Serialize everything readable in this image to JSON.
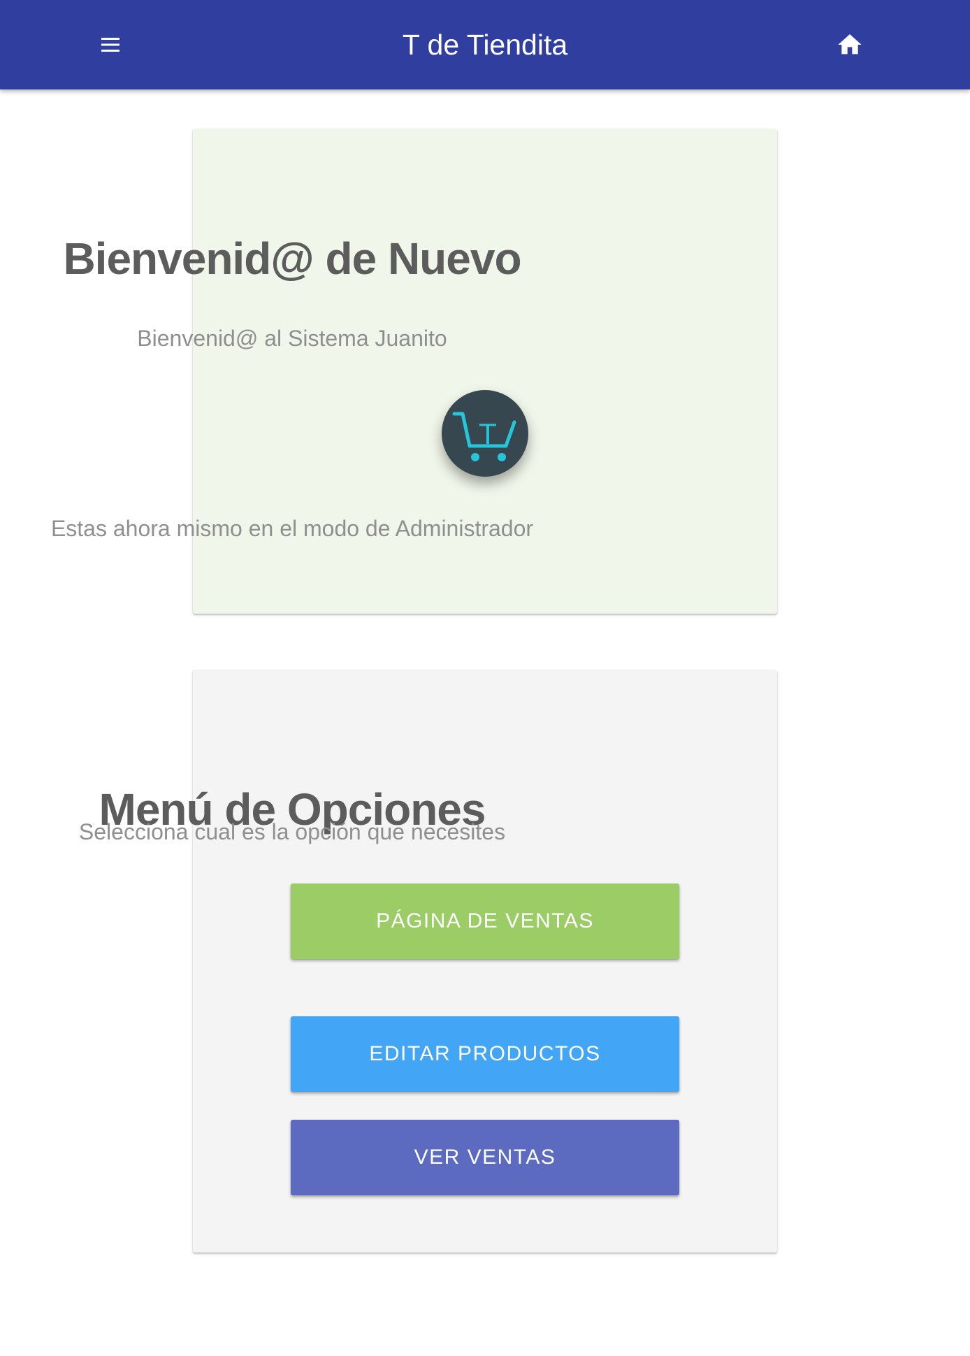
{
  "toolbar": {
    "title": "T de Tiendita",
    "menu_icon": "menu-icon",
    "home_icon": "home-icon",
    "background_color": "#303f9f"
  },
  "welcome_card": {
    "title_bold": "Bienvenid@",
    "title_rest": " de Nuevo",
    "subtitle": "Bienvenid@ al Sistema Juanito",
    "logo_icon": "shopping-cart-icon",
    "logo_letter": "T",
    "mode_text": "Estas ahora mismo en el modo de Administrador",
    "background_color": "#f1f6ea"
  },
  "menu_card": {
    "title_bold": "Menú",
    "title_rest": " de Opciones",
    "subtitle": "Selecciona cual es la opción que necesites",
    "buttons": [
      {
        "label": "PÁGINA DE VENTAS",
        "color": "#9ccc65"
      },
      {
        "label": "EDITAR PRODUCTOS",
        "color": "#42a5f5"
      },
      {
        "label": "VER VENTAS",
        "color": "#5c6bc0"
      }
    ]
  }
}
